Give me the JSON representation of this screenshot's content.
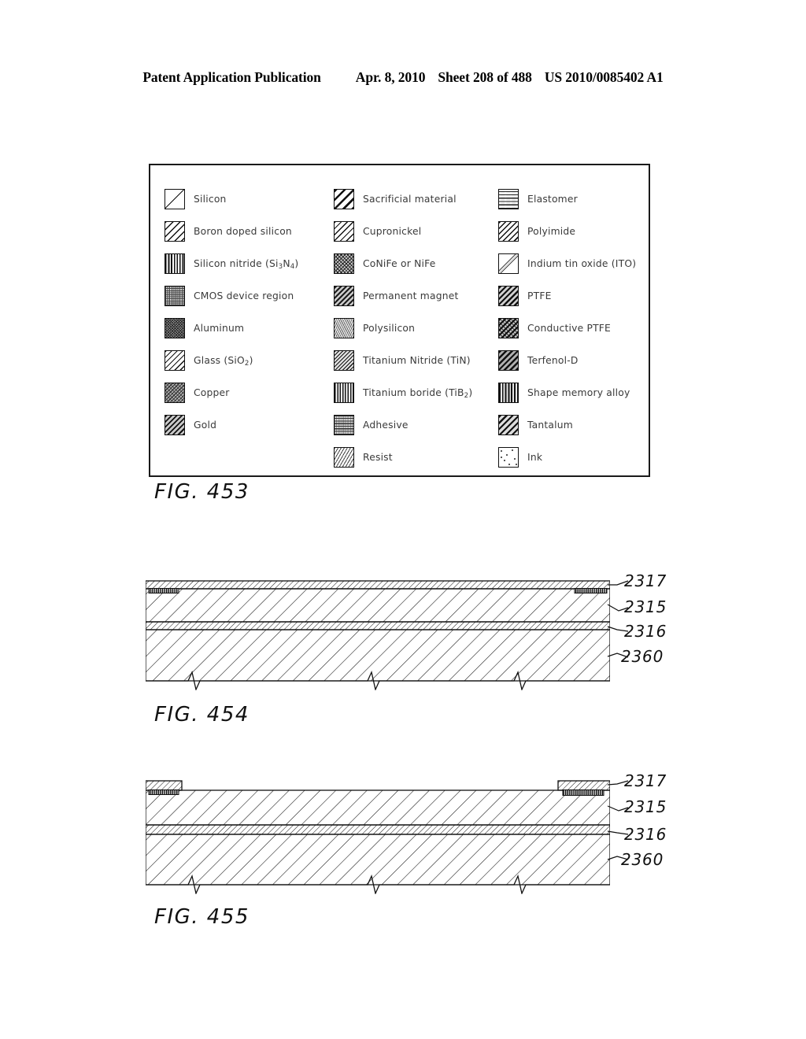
{
  "header": {
    "title": "Patent Application Publication",
    "date": "Apr. 8, 2010",
    "sheet": "Sheet 208 of 488",
    "publication_number": "US 2010/0085402 A1"
  },
  "legend": {
    "columns": [
      {
        "items": [
          {
            "pattern": "p-silicon",
            "label": "Silicon"
          },
          {
            "pattern": "p-boron",
            "label": "Boron doped silicon"
          },
          {
            "pattern": "p-nitride",
            "label": "Silicon nitride (Si3N4)",
            "label_html": "Silicon nitride (Si<sub>3</sub>N<sub>4</sub>)"
          },
          {
            "pattern": "p-cmos",
            "label": "CMOS device region"
          },
          {
            "pattern": "p-aluminum",
            "label": "Aluminum"
          },
          {
            "pattern": "p-glass",
            "label": "Glass (SiO2)",
            "label_html": "Glass (SiO<sub>2</sub>)"
          },
          {
            "pattern": "p-copper",
            "label": "Copper"
          },
          {
            "pattern": "p-gold",
            "label": "Gold"
          }
        ]
      },
      {
        "items": [
          {
            "pattern": "p-sacrificial",
            "label": "Sacrificial material"
          },
          {
            "pattern": "p-cupronickel",
            "label": "Cupronickel"
          },
          {
            "pattern": "p-conife",
            "label": "CoNiFe or NiFe"
          },
          {
            "pattern": "p-magnet",
            "label": "Permanent magnet"
          },
          {
            "pattern": "p-polysilicon",
            "label": "Polysilicon"
          },
          {
            "pattern": "p-tin",
            "label": "Titanium Nitride (TiN)"
          },
          {
            "pattern": "p-tib2",
            "label": "Titanium boride (TiB2)",
            "label_html": "Titanium boride (TiB<sub>2</sub>)"
          },
          {
            "pattern": "p-adhesive",
            "label": "Adhesive"
          },
          {
            "pattern": "p-resist",
            "label": "Resist"
          }
        ]
      },
      {
        "items": [
          {
            "pattern": "p-elastomer",
            "label": "Elastomer"
          },
          {
            "pattern": "p-polyimide",
            "label": "Polyimide"
          },
          {
            "pattern": "p-ito",
            "label": "Indium tin oxide (ITO)"
          },
          {
            "pattern": "p-ptfe",
            "label": "PTFE"
          },
          {
            "pattern": "p-cptfe",
            "label": "Conductive PTFE"
          },
          {
            "pattern": "p-terfenol",
            "label": "Terfenol-D"
          },
          {
            "pattern": "p-sma",
            "label": "Shape memory alloy"
          },
          {
            "pattern": "p-tantalum",
            "label": "Tantalum"
          },
          {
            "pattern": "p-ink",
            "label": "Ink"
          }
        ]
      }
    ]
  },
  "figures": [
    {
      "caption": "FIG. 453"
    },
    {
      "caption": "FIG. 454",
      "reference_labels": [
        "2317",
        "2315",
        "2316",
        "2360"
      ]
    },
    {
      "caption": "FIG. 455",
      "reference_labels": [
        "2317",
        "2315",
        "2316",
        "2360"
      ]
    }
  ],
  "fig454": {
    "caption": "FIG. 454",
    "labels": {
      "l1": "2317",
      "l2": "2315",
      "l3": "2316",
      "l4": "2360"
    }
  },
  "fig455": {
    "caption": "FIG. 455",
    "labels": {
      "l1": "2317",
      "l2": "2315",
      "l3": "2316",
      "l4": "2360"
    }
  },
  "fig453": {
    "caption": "FIG. 453"
  }
}
